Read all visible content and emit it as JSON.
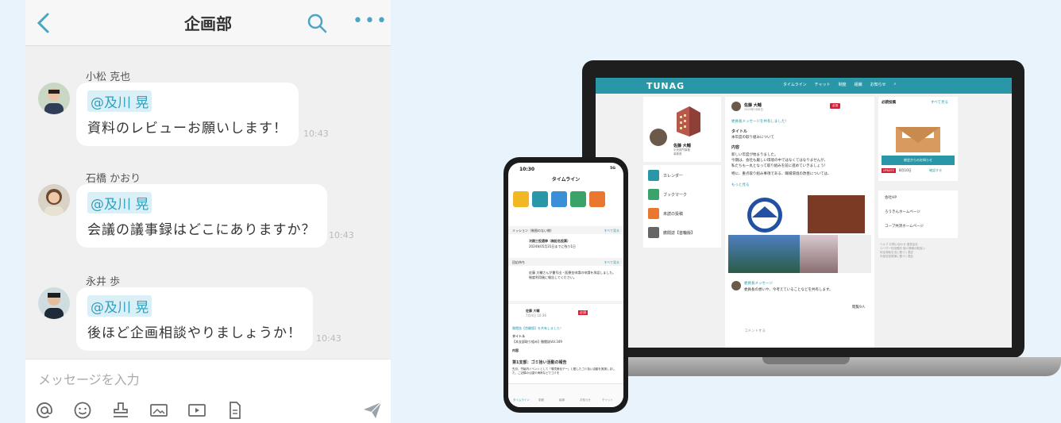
{
  "chat": {
    "title": "企画部",
    "messages": [
      {
        "sender": "小松 克也",
        "mention": "@及川 晃",
        "text": "資料のレビューお願いします！",
        "time": "10:43"
      },
      {
        "sender": "石橋 かおり",
        "mention": "@及川 晃",
        "text": "会議の議事録はどこにありますか？",
        "time": "10:43"
      },
      {
        "sender": "永井 歩",
        "mention": "@及川 晃",
        "text": "後ほど企画相談やりましょうか！",
        "time": "10:43"
      }
    ],
    "composer_placeholder": "メッセージを入力"
  },
  "laptop": {
    "brand": "TUNAG",
    "nav": [
      "タイムライン",
      "チャット",
      "制度",
      "組織",
      "お知らせ"
    ],
    "profile": {
      "name": "佐藤 大輔",
      "dept": "中央部門事務",
      "role": "事務員"
    },
    "menu": [
      "カレンダー",
      "ブックマーク",
      "未読の投稿",
      "撤閲誌【首輪版】"
    ],
    "post": {
      "author": "佐藤 大輔",
      "date": "2025年3月8日",
      "badge": "必須",
      "line1": "委員長メッセージを共有しました！",
      "heading1": "タイトル",
      "body1": "本年度の取り組みについて",
      "heading2": "内容",
      "body2": "新しい年度が始まりました。",
      "body3": "今期は、会社も厳しい環境の中ではなくてはなりませんが、",
      "body4": "私たちも一丸となって取り組みを前に進めていきましょう！",
      "body5": "特に、重点取り組み事項である、職場環境の改善については、",
      "more": "もっと見る",
      "sub_author": "委員長メッセージ",
      "sub_text": "委員長の想いや、今考えていることなどを共有します。",
      "views": "閲覧9人",
      "comment_placeholder": "コメントする"
    },
    "right": {
      "heading": "必読投稿",
      "see_all": "すべて見る",
      "notice": "総会からのお知らせ",
      "update": "UPDATE",
      "date": "8月10日",
      "confirm": "確認する"
    },
    "links": [
      "会社HP",
      "ろうきんホームページ",
      "コープ共済ホームページ"
    ],
    "footer": [
      "ヘルプ お問い合わせ 運営会社",
      "ユーザー利用規約 個人情報の取扱い",
      "特定商取引法に基づく表記",
      "外部送信規律に基づく表記"
    ]
  },
  "phone": {
    "time": "10:30",
    "signal": "5G",
    "title": "タイムライン",
    "tiles": [
      "クーポン",
      "カレンダー",
      "外部リンク",
      "ブックマーク",
      "未読の投稿",
      "撤閲誌"
    ],
    "mission_label": "ミッション（制限のない物）",
    "see_all": "すべて見る",
    "mission_title": "次期三役選挙（無記名投票）",
    "mission_due": "2024年05月31日までに残り1日",
    "reply_label": "回応待ち",
    "reply_text": "佐藤 大輔さんが書号出・医療金申請の申請を承認しました。制度利用後に報告してください。",
    "post_author": "佐藤 大輔",
    "post_date": "7月4日 10:36",
    "post_badge": "必須",
    "post_line1": "撤閲誌【首輪版】を共有しました！",
    "post_heading": "タイトル",
    "post_body": "【本支部取り組み】撤閲誌Vol.349",
    "post_heading2": "内容",
    "post_headline": "第1支部：ゴミ拾い活動の報告",
    "post_body2": "先月、労組内イベントとして「環境美化デー」と題したゴミ拾い活動を実施しました。ご近隣の公園や海岸などでゴミを",
    "tabs": [
      "タイムライン",
      "制度",
      "組織",
      "お知らせ",
      "チャット"
    ]
  },
  "colors": {
    "accent": "#2fa0c0",
    "brand": "#2a97a8",
    "required": "#d0243a"
  }
}
